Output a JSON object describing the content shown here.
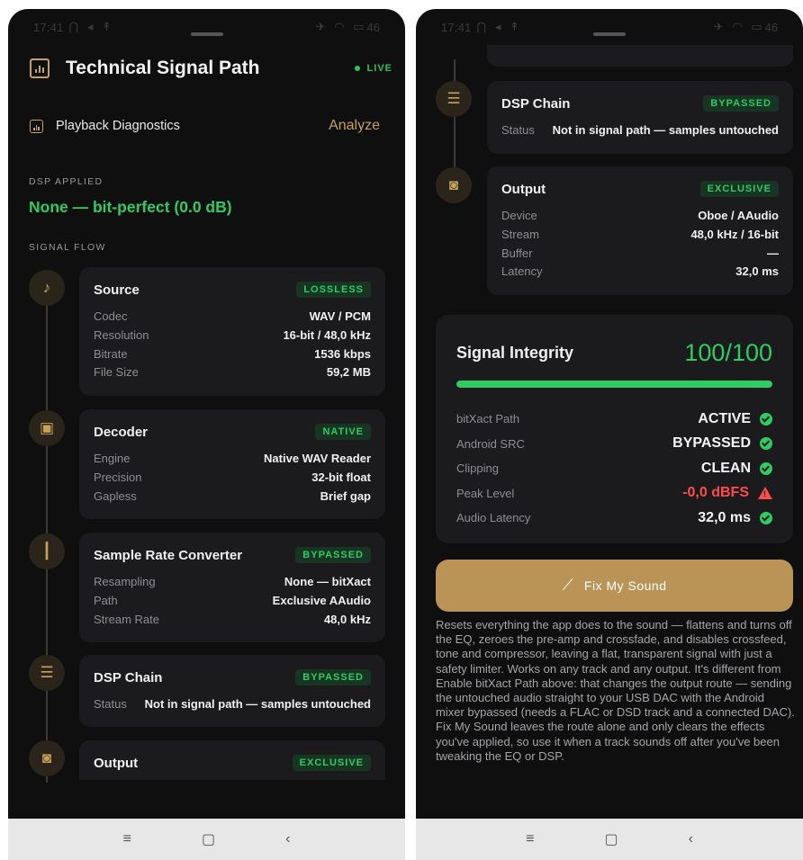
{
  "status_bar": {
    "time": "17:41",
    "left_icons": "⋂ ◂ ↟",
    "right_icons": "✈ ◠ ▭",
    "battery": "46"
  },
  "header": {
    "title": "Technical Signal Path",
    "live_label": "LIVE",
    "playback_label": "Playback Diagnostics",
    "analyze_label": "Analyze"
  },
  "dsp_applied": {
    "label": "DSP APPLIED",
    "value": "None — bit-perfect (0.0 dB)"
  },
  "signal_flow_label": "SIGNAL FLOW",
  "stages": {
    "source": {
      "icon": "music-note-icon",
      "title": "Source",
      "badge": "LOSSLESS",
      "rows": [
        {
          "k": "Codec",
          "v": "WAV / PCM"
        },
        {
          "k": "Resolution",
          "v": "16-bit / 48,0 kHz"
        },
        {
          "k": "Bitrate",
          "v": "1536 kbps"
        },
        {
          "k": "File Size",
          "v": "59,2 MB"
        }
      ]
    },
    "decoder": {
      "icon": "chip-icon",
      "title": "Decoder",
      "badge": "NATIVE",
      "rows": [
        {
          "k": "Engine",
          "v": "Native WAV Reader"
        },
        {
          "k": "Precision",
          "v": "32-bit float"
        },
        {
          "k": "Gapless",
          "v": "Brief gap"
        }
      ]
    },
    "src": {
      "icon": "waveform-icon",
      "title": "Sample Rate Converter",
      "badge": "BYPASSED",
      "rows": [
        {
          "k": "Resampling",
          "v": "None — bitXact"
        },
        {
          "k": "Path",
          "v": "Exclusive AAudio"
        },
        {
          "k": "Stream Rate",
          "v": "48,0 kHz"
        }
      ]
    },
    "dsp": {
      "icon": "sliders-icon",
      "title": "DSP Chain",
      "badge": "BYPASSED",
      "rows": [
        {
          "k": "Status",
          "v": "Not in signal path — samples untouched"
        }
      ]
    },
    "output": {
      "icon": "speaker-icon",
      "title": "Output",
      "badge": "EXCLUSIVE",
      "rows": [
        {
          "k": "Device",
          "v": "Oboe / AAudio"
        },
        {
          "k": "Stream",
          "v": "48,0 kHz / 16-bit"
        },
        {
          "k": "Buffer",
          "v": "—"
        },
        {
          "k": "Latency",
          "v": "32,0 ms"
        }
      ]
    }
  },
  "integrity": {
    "title": "Signal Integrity",
    "score": "100/100",
    "progress": 1.0,
    "rows": [
      {
        "k": "bitXact Path",
        "v": "ACTIVE",
        "status": "ok"
      },
      {
        "k": "Android SRC",
        "v": "BYPASSED",
        "status": "ok"
      },
      {
        "k": "Clipping",
        "v": "CLEAN",
        "status": "ok"
      },
      {
        "k": "Peak Level",
        "v": "-0,0 dBFS",
        "status": "warn"
      },
      {
        "k": "Audio Latency",
        "v": "32,0 ms",
        "status": "ok"
      }
    ]
  },
  "fix_button": {
    "label": "Fix My Sound",
    "icon": "magic-wand-icon"
  },
  "description": "Resets everything the app does to the sound — flattens and turns off the EQ, zeroes the pre-amp and crossfade, and disables crossfeed, tone and compressor, leaving a flat, transparent signal with just a safety limiter. Works on any track and any output. It's different from Enable bitXact Path above: that changes the output route — sending the untouched audio straight to your USB DAC with the Android mixer bypassed (needs a FLAC or DSD track and a connected DAC). Fix My Sound leaves the route alone and only clears the effects you've applied, so use it when a track sounds off after you've been tweaking the EQ or DSP.",
  "nav": {
    "menu": "≡",
    "home": "▢",
    "back": "‹"
  },
  "colors": {
    "background": "#0f0f10",
    "card": "#1b1b1e",
    "accent_gold": "#c6a15b",
    "success_green": "#2ecc63",
    "warning_red": "#ff4b4b"
  }
}
